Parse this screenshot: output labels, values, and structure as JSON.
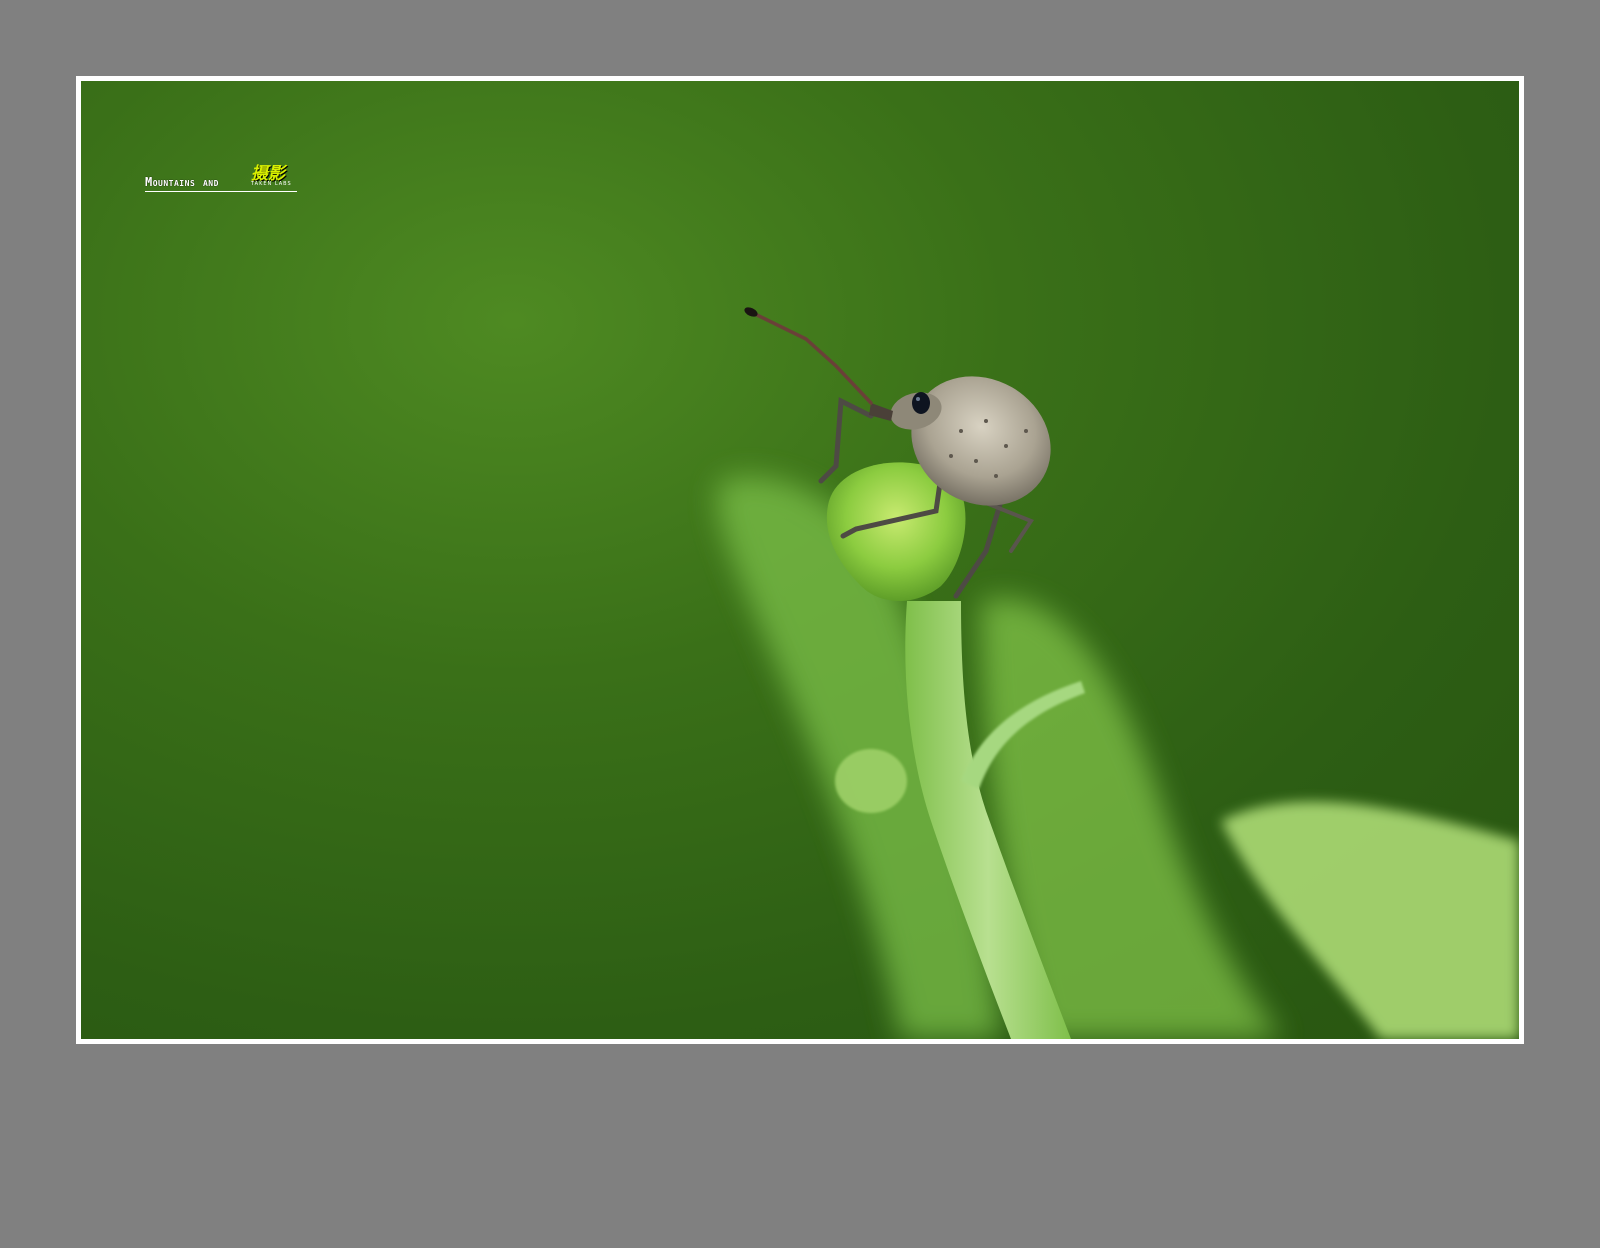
{
  "watermark": {
    "text_en": "Mountains and",
    "text_cn": "摄影",
    "subtext": "TAKEN LABS"
  },
  "colors": {
    "page_background": "#808080",
    "frame": "#ffffff",
    "photo_background": "#2d5e14",
    "watermark_accent": "#d8f000"
  }
}
